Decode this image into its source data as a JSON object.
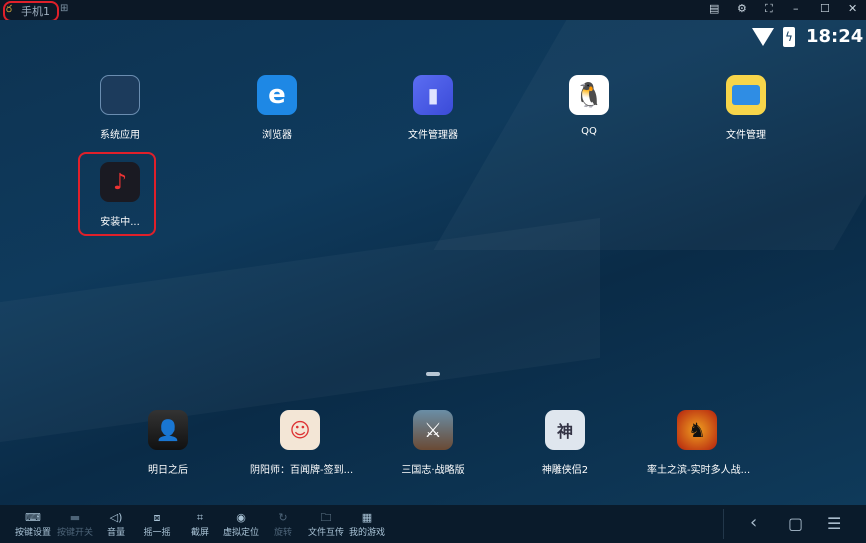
{
  "window": {
    "title": "手机1",
    "buttons": [
      "feedback",
      "settings",
      "fullscreen",
      "minimize",
      "maximize",
      "close"
    ]
  },
  "status": {
    "time": "18:24"
  },
  "apps": [
    {
      "label": "系统应用",
      "icon": "system-apps-icon"
    },
    {
      "label": "浏览器",
      "icon": "browser-icon"
    },
    {
      "label": "文件管理器",
      "icon": "file-manager-icon"
    },
    {
      "label": "QQ",
      "icon": "qq-icon"
    },
    {
      "label": "文件管理",
      "icon": "file-folder-icon"
    },
    {
      "label": "安装中...",
      "icon": "installing-app-icon"
    }
  ],
  "dock": [
    {
      "label": "明日之后"
    },
    {
      "label": "阴阳师：百闻牌-签到..."
    },
    {
      "label": "三国志·战略版"
    },
    {
      "label": "神雕侠侣2"
    },
    {
      "label": "率土之滨-实时多人战..."
    }
  ],
  "toolbar": [
    {
      "label": "按键设置",
      "icon": "keyboard-icon",
      "enabled": true
    },
    {
      "label": "按键开关",
      "icon": "toggle-icon",
      "enabled": false
    },
    {
      "label": "音量",
      "icon": "volume-icon",
      "enabled": true
    },
    {
      "label": "摇一摇",
      "icon": "shake-icon",
      "enabled": true
    },
    {
      "label": "截屏",
      "icon": "crop-icon",
      "enabled": true
    },
    {
      "label": "虚拟定位",
      "icon": "location-icon",
      "enabled": true
    },
    {
      "label": "旋转",
      "icon": "rotate-icon",
      "enabled": false
    },
    {
      "label": "文件互传",
      "icon": "file-transfer-icon",
      "enabled": true
    },
    {
      "label": "我的游戏",
      "icon": "grid-icon",
      "enabled": true
    }
  ],
  "colors": {
    "highlight": "#e0202a",
    "background": "#0f3a5c"
  }
}
